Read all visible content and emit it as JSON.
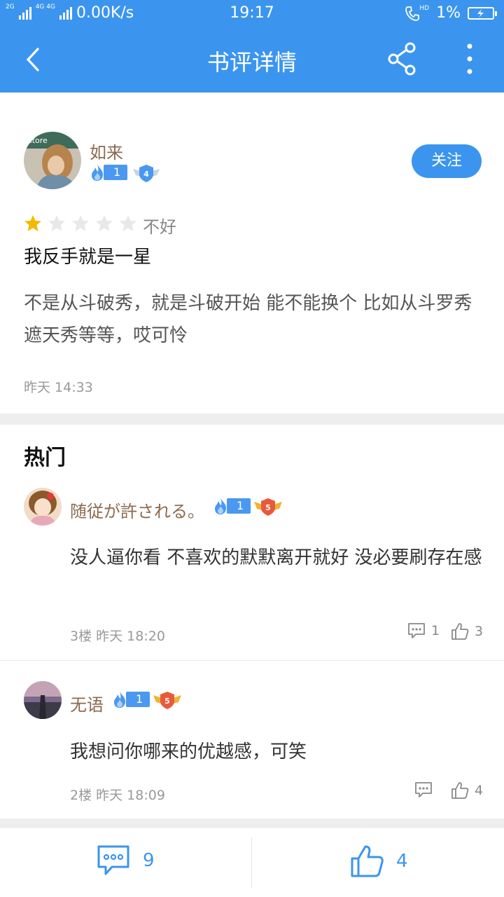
{
  "status_bar": {
    "network_a": "2G",
    "network_b": "4G 4G",
    "speed": "0.00K/s",
    "time": "19:17",
    "hd": "HD",
    "battery": "1%"
  },
  "nav": {
    "title": "书评详情",
    "icons": [
      "back-arrow-icon",
      "share-icon",
      "more-vertical-icon"
    ]
  },
  "review": {
    "author": {
      "name": "如来",
      "level": "1",
      "badge": "4"
    },
    "follow_label": "关注",
    "rating": 1,
    "rating_max": 5,
    "rating_text": "不好",
    "title": "我反手就是一星",
    "body": "不是从斗破秀，就是斗破开始 能不能换个 比如从斗罗秀 遮天秀等等，哎可怜",
    "time": "昨天 14:33"
  },
  "hot": {
    "title": "热门",
    "comments": [
      {
        "name": "随従が許される。",
        "level": "1",
        "badge": "5",
        "text": "没人逼你看 不喜欢的默默离开就好 没必要刷存在感",
        "meta": "3楼 昨天 18:20",
        "replies": "1",
        "likes": "3"
      },
      {
        "name": "无语",
        "level": "1",
        "badge": "5",
        "text": "我想问你哪来的优越感，可笑",
        "meta": "2楼 昨天 18:09",
        "replies": "",
        "likes": "4"
      }
    ]
  },
  "bottom_bar": {
    "comment_count": "9",
    "like_count": "4"
  },
  "colors": {
    "primary": "#3b95ee",
    "username": "#8b6a4f",
    "star": "#f5b800",
    "badge_gold": "#f2b233"
  }
}
